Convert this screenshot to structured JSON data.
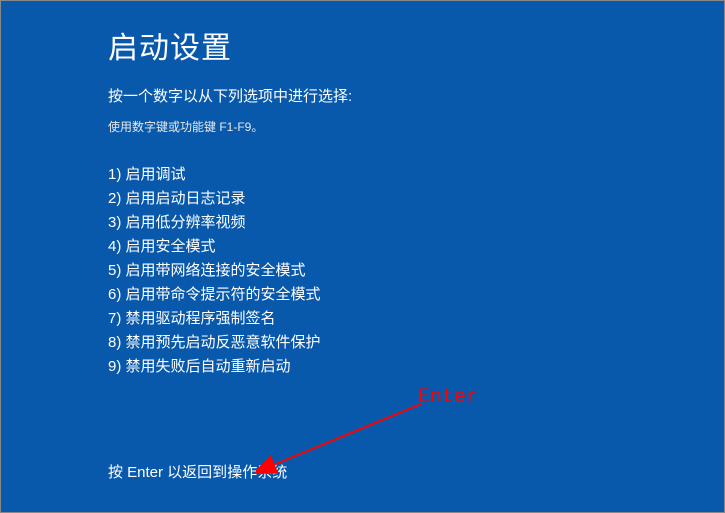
{
  "title": "启动设置",
  "instruction": "按一个数字以从下列选项中进行选择:",
  "subInstruction": "使用数字键或功能键 F1-F9。",
  "options": [
    "1) 启用调试",
    "2) 启用启动日志记录",
    "3) 启用低分辨率视频",
    "4) 启用安全模式",
    "5) 启用带网络连接的安全模式",
    "6) 启用带命令提示符的安全模式",
    "7) 禁用驱动程序强制签名",
    "8) 禁用预先启动反恶意软件保护",
    "9) 禁用失败后自动重新启动"
  ],
  "footerInstruction": "按 Enter 以返回到操作系统",
  "annotation": {
    "label": "Enter"
  }
}
